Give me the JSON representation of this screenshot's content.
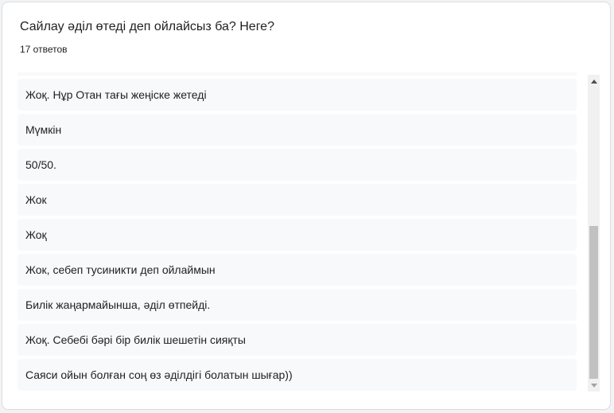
{
  "question": {
    "title": "Сайлау әділ өтеді деп ойлайсыз ба? Неге?",
    "response_count": "17 ответов"
  },
  "responses": [
    "Жоқ. Нұр Отан тағы жеңіске жетеді",
    "Мүмкін",
    "50/50.",
    "Жок",
    "Жоқ",
    "Жок, себеп тусиникти деп ойлаймын",
    "Билік жаңармайынша, әділ өтпейді.",
    "Жоқ. Себебі бәрі бір билік шешетін сияқты",
    "Саяси ойын болған соң өз әділдігі болатын шығар))"
  ],
  "scroll": {
    "position_fraction": 1.0
  }
}
